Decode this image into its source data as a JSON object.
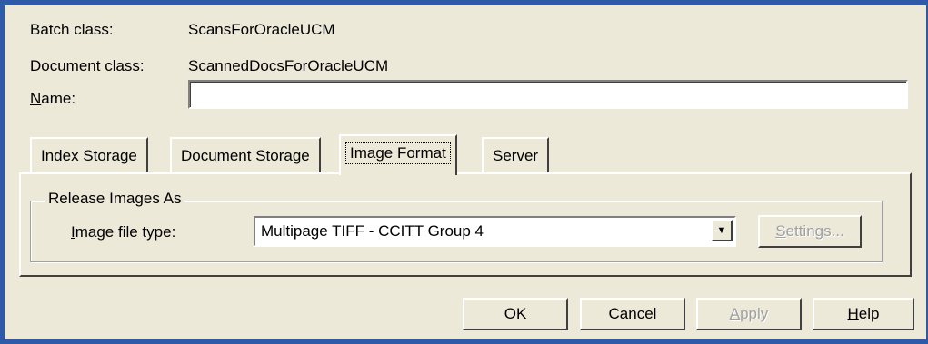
{
  "header": {
    "batch_class_label": "Batch class:",
    "batch_class_value": "ScansForOracleUCM",
    "document_class_label": "Document class:",
    "document_class_value": "ScannedDocsForOracleUCM",
    "name_label_prefix": "",
    "name_label_mnemonic": "N",
    "name_label_rest": "ame:",
    "name_value": ""
  },
  "tabs": [
    {
      "label": "Index Storage",
      "active": false
    },
    {
      "label": "Document Storage",
      "active": false
    },
    {
      "label": "Image Format",
      "active": true
    },
    {
      "label": "Server",
      "active": false
    }
  ],
  "release_group": {
    "legend": "Release Images As",
    "file_type_label_mnemonic": "I",
    "file_type_label_rest": "mage file type:",
    "file_type_value": "Multipage TIFF - CCITT Group 4",
    "settings_mnemonic": "S",
    "settings_rest": "ettings..."
  },
  "buttons": {
    "ok": "OK",
    "cancel": "Cancel",
    "apply_mnemonic": "A",
    "apply_rest": "pply",
    "help_mnemonic": "H",
    "help_rest": "elp"
  },
  "colors": {
    "window_border": "#2f5aa8",
    "dialog_bg": "#ece9d8",
    "disabled_text": "#a0a0a0"
  }
}
